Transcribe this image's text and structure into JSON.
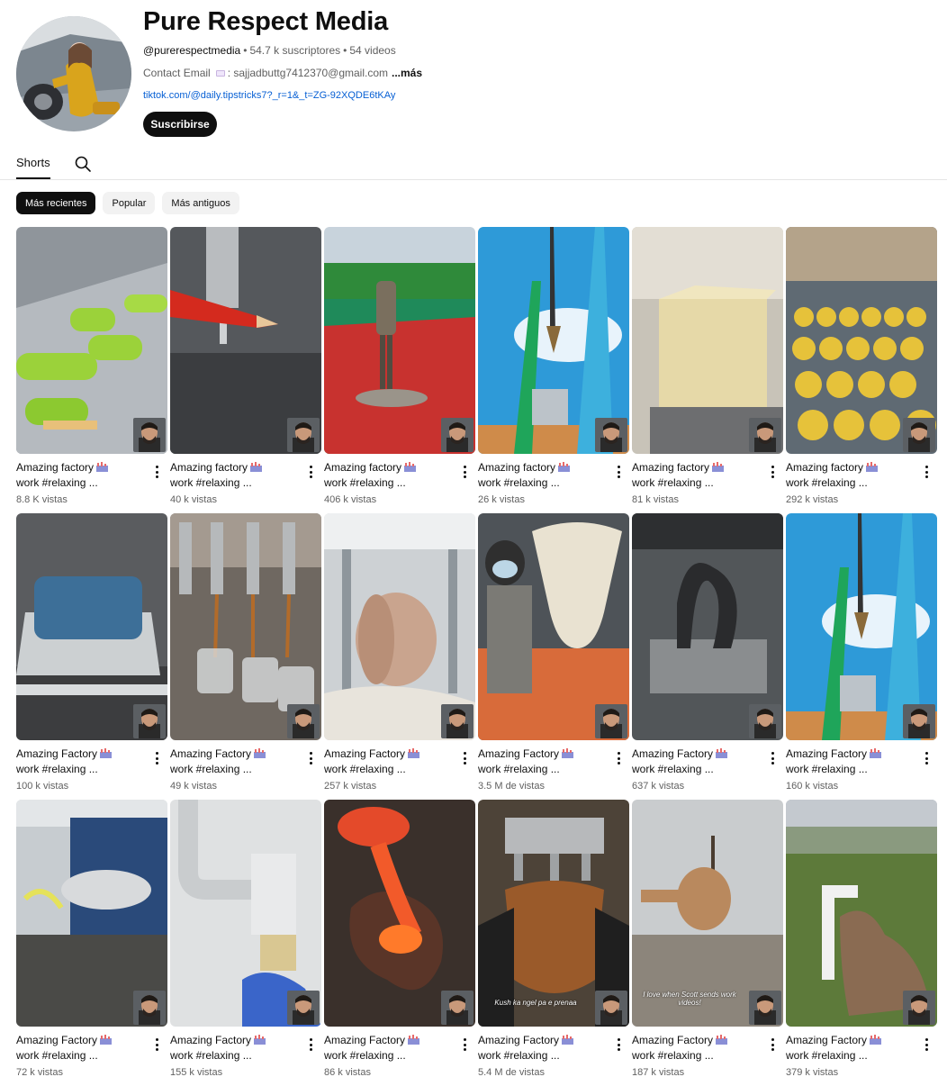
{
  "channel": {
    "title": "Pure Respect Media",
    "handle": "@purerespectmedia",
    "subscribers": "54.7 k suscriptores",
    "videos": "54 videos",
    "contact_prefix": "Contact Email",
    "contact_value": ": sajjadbuttg7412370@gmail.com",
    "more_label": "...más",
    "link": "tiktok.com/@daily.tipstricks7?_r=1&_t=ZG-92XQDE6tKAy",
    "subscribe_label": "Suscribirse"
  },
  "tabs": {
    "shorts_label": "Shorts"
  },
  "chips": [
    "Más recientes",
    "Popular",
    "Más antiguos"
  ],
  "colors": {
    "accent": "#0f0f0f",
    "link": "#065fd4",
    "muted": "#606060"
  },
  "shorts": [
    {
      "line1": "Amazing factory",
      "line2": "work #relaxing ...",
      "views": "8.8 K vistas",
      "scene": "ice"
    },
    {
      "line1": "Amazing factory",
      "line2": "work #relaxing ...",
      "views": "40 k vistas",
      "scene": "pencil"
    },
    {
      "line1": "Amazing factory",
      "line2": "work #relaxing ...",
      "views": "406 k vistas",
      "scene": "court"
    },
    {
      "line1": "Amazing factory",
      "line2": "work #relaxing ...",
      "views": "26 k vistas",
      "scene": "crane"
    },
    {
      "line1": "Amazing factory",
      "line2": "work #relaxing ...",
      "views": "81 k vistas",
      "scene": "soap"
    },
    {
      "line1": "Amazing factory",
      "line2": "work #relaxing ...",
      "views": "292 k vistas",
      "scene": "cans"
    },
    {
      "line1": "Amazing Factory",
      "line2": "work #relaxing ...",
      "views": "100 k vistas",
      "scene": "mold"
    },
    {
      "line1": "Amazing Factory",
      "line2": "work #relaxing ...",
      "views": "49 k vistas",
      "scene": "jars"
    },
    {
      "line1": "Amazing Factory",
      "line2": "work #relaxing ...",
      "views": "257 k vistas",
      "scene": "paper"
    },
    {
      "line1": "Amazing Factory",
      "line2": "work #relaxing ...",
      "views": "3.5 M de vistas",
      "scene": "bell"
    },
    {
      "line1": "Amazing Factory",
      "line2": "work #relaxing ...",
      "views": "637 k vistas",
      "scene": "press"
    },
    {
      "line1": "Amazing Factory",
      "line2": "work #relaxing ...",
      "views": "160 k vistas",
      "scene": "crane"
    },
    {
      "line1": "Amazing Factory",
      "line2": "work #relaxing ...",
      "views": "72 k vistas",
      "scene": "truck"
    },
    {
      "line1": "Amazing Factory",
      "line2": "work #relaxing ...",
      "views": "155 k vistas",
      "scene": "pipes"
    },
    {
      "line1": "Amazing Factory",
      "line2": "work #relaxing ...",
      "views": "86 k vistas",
      "scene": "glass"
    },
    {
      "line1": "Amazing Factory",
      "line2": "work #relaxing ...",
      "views": "5.4 M de vistas",
      "scene": "cake",
      "overlay": "Kush ka ngel pa e prenaa"
    },
    {
      "line1": "Amazing Factory",
      "line2": "work #relaxing ...",
      "views": "187 k vistas",
      "scene": "gourd",
      "overlay": "I love when Scott sends work videos!"
    },
    {
      "line1": "Amazing Factory",
      "line2": "work #relaxing ...",
      "views": "379 k vistas",
      "scene": "pipe"
    }
  ]
}
